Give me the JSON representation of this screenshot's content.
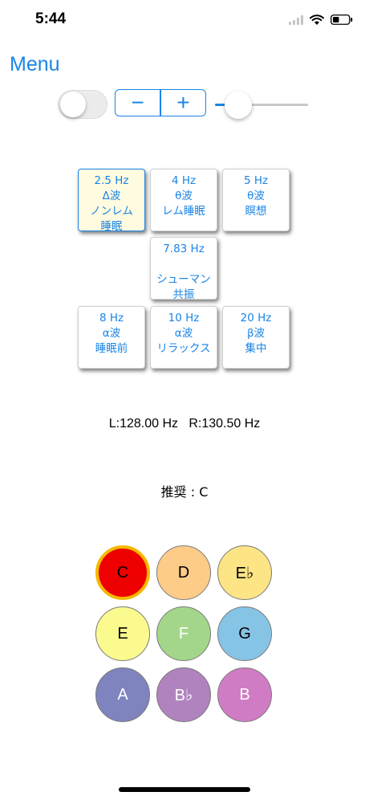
{
  "status_bar": {
    "time": "5:44"
  },
  "nav": {
    "menu_label": "Menu"
  },
  "controls": {
    "toggle_on": false,
    "stepper_minus": "−",
    "stepper_plus": "+",
    "slider_value": 0.25,
    "accent_color": "#1a84e6"
  },
  "frequency_buttons": [
    {
      "hz": "2.5 Hz",
      "line2": "Δ波",
      "line3": "ノンレム",
      "line4": "睡眠",
      "selected": true
    },
    {
      "hz": "4 Hz",
      "line2": "θ波",
      "line3": "レム睡眠",
      "line4": ""
    },
    {
      "hz": "5 Hz",
      "line2": "θ波",
      "line3": "瞑想",
      "line4": ""
    },
    {
      "hz": "7.83 Hz",
      "line2": "",
      "line3": "シューマン",
      "line4": "共振"
    },
    {
      "hz": "8 Hz",
      "line2": "α波",
      "line3": "睡眠前",
      "line4": ""
    },
    {
      "hz": "10 Hz",
      "line2": "α波",
      "line3": "リラックス",
      "line4": ""
    },
    {
      "hz": "20 Hz",
      "line2": "β波",
      "line3": "集中",
      "line4": ""
    }
  ],
  "readout": {
    "frequencies": "L:128.00 Hz   R:130.50 Hz"
  },
  "recommendation": {
    "text": "推奨 : C"
  },
  "notes": [
    {
      "label": "C",
      "color": "#ee0000",
      "text_color": "#000000",
      "selected": true
    },
    {
      "label": "D",
      "color": "#fdcc88",
      "text_color": "#000000"
    },
    {
      "label": "E♭",
      "color": "#fde485",
      "text_color": "#000000"
    },
    {
      "label": "E",
      "color": "#fbfa8e",
      "text_color": "#000000"
    },
    {
      "label": "F",
      "color": "#a3d68a",
      "text_color": "#ffffff"
    },
    {
      "label": "G",
      "color": "#86c4e6",
      "text_color": "#000000"
    },
    {
      "label": "A",
      "color": "#7f83be",
      "text_color": "#ffffff"
    },
    {
      "label": "B♭",
      "color": "#b083be",
      "text_color": "#ffffff"
    },
    {
      "label": "B",
      "color": "#d07cc4",
      "text_color": "#ffffff"
    }
  ]
}
